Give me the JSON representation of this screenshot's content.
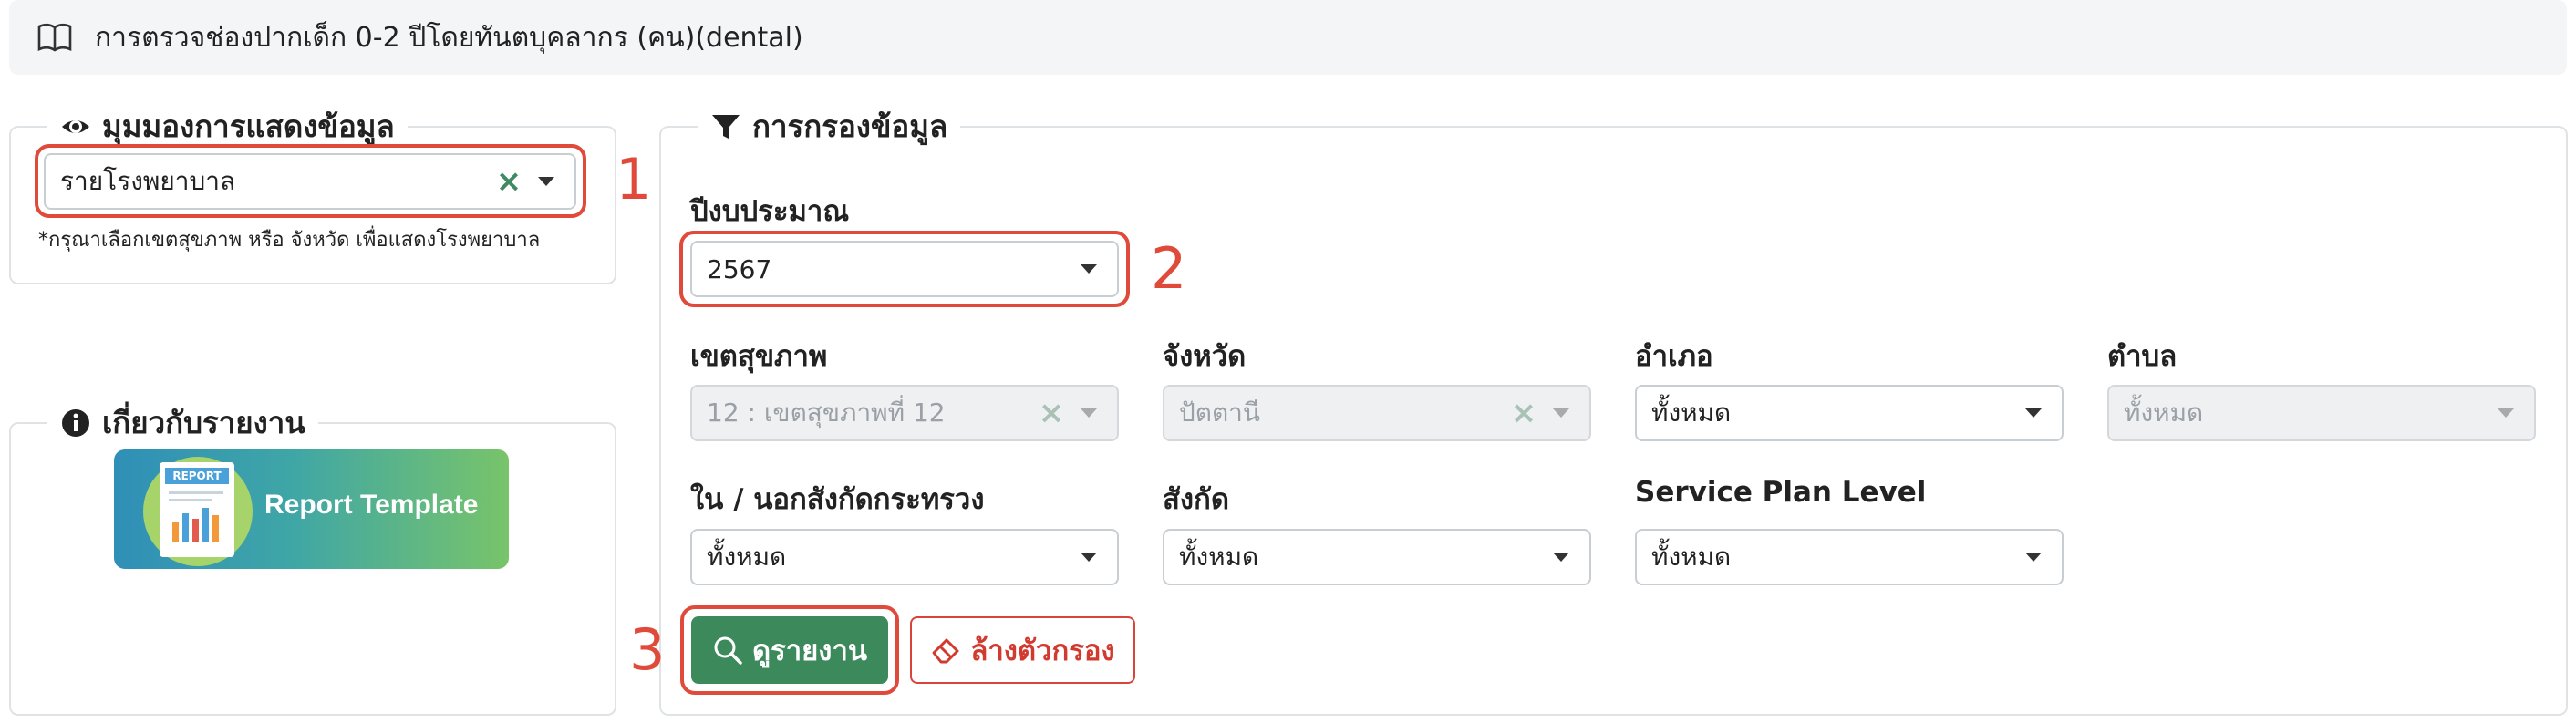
{
  "header": {
    "title": "การตรวจช่องปากเด็ก 0-2 ปีโดยทันตบุคลากร (คน)(dental)"
  },
  "view_panel": {
    "legend": "มุมมองการแสดงข้อมูล",
    "select_value": "รายโรงพยาบาล",
    "note": "*กรุณาเลือกเขตสุขภาพ หรือ จังหวัด เพื่อแสดงโรงพยาบาล"
  },
  "about_panel": {
    "legend": "เกี่ยวกับรายงาน",
    "banner_text": "Report Template",
    "banner_badge": "REPORT"
  },
  "filter_panel": {
    "legend": "การกรองข้อมูล",
    "budget_year": {
      "label": "ปีงบประมาณ",
      "value": "2567"
    },
    "region": {
      "label": "เขตสุขภาพ",
      "value": "12 : เขตสุขภาพที่ 12"
    },
    "province": {
      "label": "จังหวัด",
      "value": "ปัตตานี"
    },
    "district": {
      "label": "อำเภอ",
      "value": "ทั้งหมด"
    },
    "subdistrict": {
      "label": "ตำบล",
      "value": "ทั้งหมด"
    },
    "ministry": {
      "label": "ใน / นอกสังกัดกระทรวง",
      "value": "ทั้งหมด"
    },
    "affiliation": {
      "label": "สังกัด",
      "value": "ทั้งหมด"
    },
    "service_plan": {
      "label": "Service Plan Level",
      "value": "ทั้งหมด"
    },
    "view_button": "ดูรายงาน",
    "clear_button": "ล้างตัวกรอง"
  },
  "annotations": {
    "one": "1",
    "two": "2",
    "three": "3"
  },
  "colors": {
    "accent_green": "#3c8a5b",
    "annotation_red": "#e04a3a",
    "danger_red": "#d23a2f"
  }
}
